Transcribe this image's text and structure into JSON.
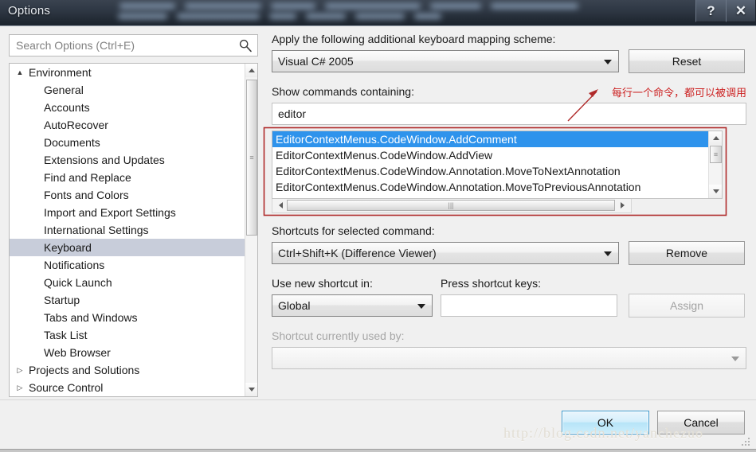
{
  "window": {
    "title": "Options",
    "help_button": "?",
    "close_button": "✕",
    "help_icon_name": "help-icon",
    "close_icon_name": "close-icon"
  },
  "search": {
    "placeholder": "Search Options (Ctrl+E)",
    "value": "",
    "icon": "search-icon"
  },
  "tree": {
    "items": [
      {
        "label": "Environment",
        "level": 0,
        "twisty": "▲",
        "expanded": true,
        "selected": false
      },
      {
        "label": "General",
        "level": 1,
        "twisty": "",
        "expanded": false,
        "selected": false
      },
      {
        "label": "Accounts",
        "level": 1,
        "twisty": "",
        "expanded": false,
        "selected": false
      },
      {
        "label": "AutoRecover",
        "level": 1,
        "twisty": "",
        "expanded": false,
        "selected": false
      },
      {
        "label": "Documents",
        "level": 1,
        "twisty": "",
        "expanded": false,
        "selected": false
      },
      {
        "label": "Extensions and Updates",
        "level": 1,
        "twisty": "",
        "expanded": false,
        "selected": false
      },
      {
        "label": "Find and Replace",
        "level": 1,
        "twisty": "",
        "expanded": false,
        "selected": false
      },
      {
        "label": "Fonts and Colors",
        "level": 1,
        "twisty": "",
        "expanded": false,
        "selected": false
      },
      {
        "label": "Import and Export Settings",
        "level": 1,
        "twisty": "",
        "expanded": false,
        "selected": false
      },
      {
        "label": "International Settings",
        "level": 1,
        "twisty": "",
        "expanded": false,
        "selected": false
      },
      {
        "label": "Keyboard",
        "level": 1,
        "twisty": "",
        "expanded": false,
        "selected": true
      },
      {
        "label": "Notifications",
        "level": 1,
        "twisty": "",
        "expanded": false,
        "selected": false
      },
      {
        "label": "Quick Launch",
        "level": 1,
        "twisty": "",
        "expanded": false,
        "selected": false
      },
      {
        "label": "Startup",
        "level": 1,
        "twisty": "",
        "expanded": false,
        "selected": false
      },
      {
        "label": "Tabs and Windows",
        "level": 1,
        "twisty": "",
        "expanded": false,
        "selected": false
      },
      {
        "label": "Task List",
        "level": 1,
        "twisty": "",
        "expanded": false,
        "selected": false
      },
      {
        "label": "Web Browser",
        "level": 1,
        "twisty": "",
        "expanded": false,
        "selected": false
      },
      {
        "label": "Projects and Solutions",
        "level": 0,
        "twisty": "▷",
        "expanded": false,
        "selected": false
      },
      {
        "label": "Source Control",
        "level": 0,
        "twisty": "▷",
        "expanded": false,
        "selected": false
      }
    ]
  },
  "keyboard_page": {
    "scheme_label": "Apply the following additional keyboard mapping scheme:",
    "scheme_value": "Visual C# 2005",
    "reset_button": "Reset",
    "filter_label": "Show commands containing:",
    "filter_value": "editor",
    "commands": [
      "EditorContextMenus.CodeWindow.AddComment",
      "EditorContextMenus.CodeWindow.AddView",
      "EditorContextMenus.CodeWindow.Annotation.MoveToNextAnnotation",
      "EditorContextMenus.CodeWindow.Annotation.MoveToPreviousAnnotation"
    ],
    "selected_command_index": 0,
    "shortcuts_label": "Shortcuts for selected command:",
    "shortcuts_value": "Ctrl+Shift+K (Difference Viewer)",
    "remove_button": "Remove",
    "scope_label": "Use new shortcut in:",
    "scope_value": "Global",
    "press_keys_label": "Press shortcut keys:",
    "press_keys_value": "",
    "assign_button": "Assign",
    "used_by_label": "Shortcut currently used by:",
    "used_by_value": ""
  },
  "footer": {
    "ok_button": "OK",
    "cancel_button": "Cancel",
    "watermark": "http://blog.csdn.net/yanchezuo"
  },
  "annotation": {
    "note_text": "每行一个命令，都可以被调用",
    "color": "#cc2020"
  }
}
